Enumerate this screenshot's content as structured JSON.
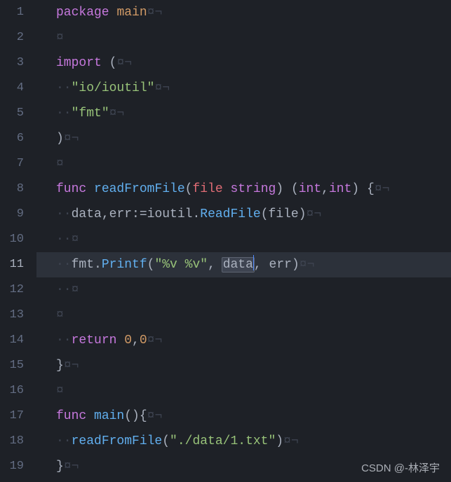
{
  "watermark": "CSDN @-林泽宇",
  "active_line": 11,
  "lines": [
    {
      "n": 1,
      "tokens": [
        {
          "cls": "tok-keyword",
          "t": "package"
        },
        {
          "cls": "sp",
          "t": " "
        },
        {
          "cls": "tok-package",
          "t": "main"
        },
        {
          "cls": "whitespace",
          "t": "¤¬"
        }
      ]
    },
    {
      "n": 2,
      "tokens": [
        {
          "cls": "whitespace",
          "t": "¤"
        }
      ]
    },
    {
      "n": 3,
      "tokens": [
        {
          "cls": "tok-keyword",
          "t": "import"
        },
        {
          "cls": "sp",
          "t": " "
        },
        {
          "cls": "tok-punct",
          "t": "("
        },
        {
          "cls": "whitespace",
          "t": "¤¬"
        }
      ]
    },
    {
      "n": 4,
      "tokens": [
        {
          "cls": "whitespace",
          "t": "··"
        },
        {
          "cls": "tok-string",
          "t": "\"io/ioutil\""
        },
        {
          "cls": "whitespace",
          "t": "¤¬"
        }
      ]
    },
    {
      "n": 5,
      "tokens": [
        {
          "cls": "whitespace",
          "t": "··"
        },
        {
          "cls": "tok-string",
          "t": "\"fmt\""
        },
        {
          "cls": "whitespace",
          "t": "¤¬"
        }
      ]
    },
    {
      "n": 6,
      "tokens": [
        {
          "cls": "tok-punct",
          "t": ")"
        },
        {
          "cls": "whitespace",
          "t": "¤¬"
        }
      ]
    },
    {
      "n": 7,
      "tokens": [
        {
          "cls": "whitespace",
          "t": "¤"
        }
      ]
    },
    {
      "n": 8,
      "tokens": [
        {
          "cls": "tok-keyword",
          "t": "func"
        },
        {
          "cls": "sp",
          "t": " "
        },
        {
          "cls": "tok-funcdef",
          "t": "readFromFile"
        },
        {
          "cls": "tok-punct",
          "t": "("
        },
        {
          "cls": "tok-var",
          "t": "file"
        },
        {
          "cls": "sp",
          "t": " "
        },
        {
          "cls": "tok-type",
          "t": "string"
        },
        {
          "cls": "tok-punct",
          "t": ")"
        },
        {
          "cls": "sp",
          "t": " "
        },
        {
          "cls": "tok-punct",
          "t": "("
        },
        {
          "cls": "tok-type",
          "t": "int"
        },
        {
          "cls": "tok-punct",
          "t": ","
        },
        {
          "cls": "tok-type",
          "t": "int"
        },
        {
          "cls": "tok-punct",
          "t": ")"
        },
        {
          "cls": "sp",
          "t": " "
        },
        {
          "cls": "tok-punct",
          "t": "{"
        },
        {
          "cls": "whitespace",
          "t": "¤¬"
        }
      ]
    },
    {
      "n": 9,
      "tokens": [
        {
          "cls": "whitespace",
          "t": "··"
        },
        {
          "cls": "tok-default",
          "t": "data"
        },
        {
          "cls": "tok-punct",
          "t": ","
        },
        {
          "cls": "tok-default",
          "t": "err"
        },
        {
          "cls": "tok-punct",
          "t": ":="
        },
        {
          "cls": "tok-default",
          "t": "ioutil"
        },
        {
          "cls": "tok-dot",
          "t": "."
        },
        {
          "cls": "tok-func",
          "t": "ReadFile"
        },
        {
          "cls": "tok-punct",
          "t": "("
        },
        {
          "cls": "tok-default",
          "t": "file"
        },
        {
          "cls": "tok-punct",
          "t": ")"
        },
        {
          "cls": "whitespace",
          "t": "¤¬"
        }
      ]
    },
    {
      "n": 10,
      "tokens": [
        {
          "cls": "whitespace",
          "t": "··¤"
        }
      ]
    },
    {
      "n": 11,
      "tokens": [
        {
          "cls": "whitespace",
          "t": "··"
        },
        {
          "cls": "tok-default",
          "t": "fmt"
        },
        {
          "cls": "tok-dot",
          "t": "."
        },
        {
          "cls": "tok-func",
          "t": "Printf"
        },
        {
          "cls": "tok-punct",
          "t": "("
        },
        {
          "cls": "tok-string",
          "t": "\"%v %v\""
        },
        {
          "cls": "tok-punct",
          "t": ","
        },
        {
          "cls": "sp",
          "t": " "
        },
        {
          "cls": "tok-default selected-word",
          "t": "data"
        },
        {
          "cls": "cursor",
          "t": ""
        },
        {
          "cls": "tok-punct",
          "t": ","
        },
        {
          "cls": "sp",
          "t": " "
        },
        {
          "cls": "tok-default",
          "t": "err"
        },
        {
          "cls": "tok-punct",
          "t": ")"
        },
        {
          "cls": "whitespace",
          "t": "¤¬"
        }
      ]
    },
    {
      "n": 12,
      "tokens": [
        {
          "cls": "whitespace",
          "t": "··¤"
        }
      ]
    },
    {
      "n": 13,
      "tokens": [
        {
          "cls": "whitespace",
          "t": "¤"
        }
      ]
    },
    {
      "n": 14,
      "tokens": [
        {
          "cls": "whitespace",
          "t": "··"
        },
        {
          "cls": "tok-keyword",
          "t": "return"
        },
        {
          "cls": "sp",
          "t": " "
        },
        {
          "cls": "tok-number",
          "t": "0"
        },
        {
          "cls": "tok-punct",
          "t": ","
        },
        {
          "cls": "tok-number",
          "t": "0"
        },
        {
          "cls": "whitespace",
          "t": "¤¬"
        }
      ]
    },
    {
      "n": 15,
      "tokens": [
        {
          "cls": "tok-punct",
          "t": "}"
        },
        {
          "cls": "whitespace",
          "t": "¤¬"
        }
      ]
    },
    {
      "n": 16,
      "tokens": [
        {
          "cls": "whitespace",
          "t": "¤"
        }
      ]
    },
    {
      "n": 17,
      "tokens": [
        {
          "cls": "tok-keyword",
          "t": "func"
        },
        {
          "cls": "sp",
          "t": " "
        },
        {
          "cls": "tok-funcdef",
          "t": "main"
        },
        {
          "cls": "tok-punct",
          "t": "(){"
        },
        {
          "cls": "whitespace",
          "t": "¤¬"
        }
      ]
    },
    {
      "n": 18,
      "tokens": [
        {
          "cls": "whitespace",
          "t": "··"
        },
        {
          "cls": "tok-func",
          "t": "readFromFile"
        },
        {
          "cls": "tok-punct",
          "t": "("
        },
        {
          "cls": "tok-string",
          "t": "\"./data/1.txt\""
        },
        {
          "cls": "tok-punct",
          "t": ")"
        },
        {
          "cls": "whitespace",
          "t": "¤¬"
        }
      ]
    },
    {
      "n": 19,
      "tokens": [
        {
          "cls": "tok-punct",
          "t": "}"
        },
        {
          "cls": "whitespace",
          "t": "¤¬"
        }
      ]
    }
  ]
}
